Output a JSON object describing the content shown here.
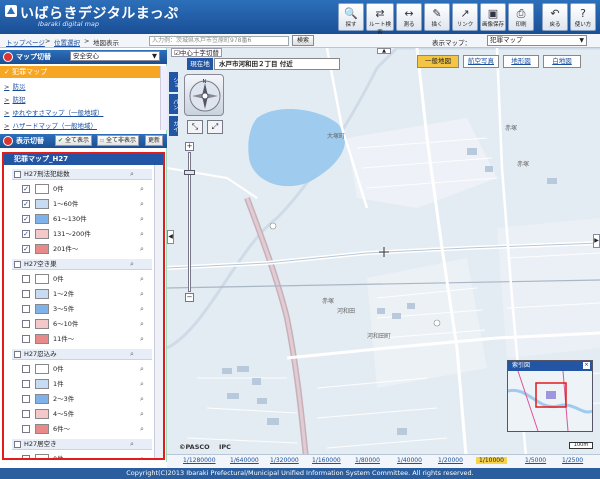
{
  "app": {
    "title": "いばらきデジタルまっぷ",
    "subtitle": "Ibaraki digital map"
  },
  "header_buttons": [
    {
      "label": "探す",
      "icon": "search-icon"
    },
    {
      "label": "ルート検索",
      "icon": "route-icon"
    },
    {
      "label": "測る",
      "icon": "measure-icon"
    },
    {
      "label": "描く",
      "icon": "draw-icon"
    },
    {
      "label": "リンク",
      "icon": "link-icon"
    },
    {
      "label": "画像保存",
      "icon": "save-image-icon"
    },
    {
      "label": "印刷",
      "icon": "print-icon"
    },
    {
      "label": "戻る",
      "icon": "back-icon"
    },
    {
      "label": "使い方",
      "icon": "help-icon"
    }
  ],
  "breadcrumb": {
    "top": "トップページ",
    "search": "位置選択",
    "current": "地図表示"
  },
  "address_search": {
    "placeholder": "入力例：茨城県水戸市笠原町978番6",
    "button": "検索"
  },
  "map_select": {
    "label": "表示マップ：",
    "value": "犯罪マップ"
  },
  "sidebar": {
    "map_switch_title": "マップ切替",
    "theme_value": "安全安心",
    "selected_item": "犯罪マップ",
    "items": [
      "防災",
      "防犯",
      "ゆれやすさマップ（一般地域）",
      "ハザードマップ（一般地域）"
    ],
    "display_switch_title": "表示切替",
    "show_all": "全て表示",
    "hide_all": "全て非表示",
    "refresh": "更新"
  },
  "layer_panel": {
    "title": "犯罪マップ_H27",
    "groups": [
      {
        "name": "H27刑法犯総数",
        "rows": [
          {
            "label": "0件",
            "color": "#ffffff",
            "checked": true
          },
          {
            "label": "1〜60件",
            "color": "#c7dcf2",
            "checked": true
          },
          {
            "label": "61〜130件",
            "color": "#7fb1ea",
            "checked": true
          },
          {
            "label": "131〜200件",
            "color": "#f4c8c8",
            "checked": true
          },
          {
            "label": "201件〜",
            "color": "#e98a8a",
            "checked": true
          }
        ]
      },
      {
        "name": "H27空き巣",
        "rows": [
          {
            "label": "0件",
            "color": "#ffffff",
            "checked": false
          },
          {
            "label": "1〜2件",
            "color": "#c7dcf2",
            "checked": false
          },
          {
            "label": "3〜5件",
            "color": "#7fb1ea",
            "checked": false
          },
          {
            "label": "6〜10件",
            "color": "#f4c8c8",
            "checked": false
          },
          {
            "label": "11件〜",
            "color": "#e98a8a",
            "checked": false
          }
        ]
      },
      {
        "name": "H27忍込み",
        "rows": [
          {
            "label": "0件",
            "color": "#ffffff",
            "checked": false
          },
          {
            "label": "1件",
            "color": "#c7dcf2",
            "checked": false
          },
          {
            "label": "2〜3件",
            "color": "#7fb1ea",
            "checked": false
          },
          {
            "label": "4〜5件",
            "color": "#f4c8c8",
            "checked": false
          },
          {
            "label": "6件〜",
            "color": "#e98a8a",
            "checked": false
          }
        ]
      },
      {
        "name": "H27居空き",
        "rows": [
          {
            "label": "0件",
            "color": "#ffffff",
            "checked": false
          },
          {
            "label": "1件",
            "color": "#c7dcf2",
            "checked": false
          }
        ]
      }
    ]
  },
  "map": {
    "center_toggle": "中心十字切替",
    "location_label": "現在地",
    "location_value": "水戸市河和田２丁目 付近",
    "tabs": [
      "一般地図",
      "航空写真",
      "地形図",
      "白地図"
    ],
    "active_tab": "一般地図",
    "side_tabs": [
      "ショ",
      "パン",
      "ガイ"
    ],
    "overview_title": "索引図",
    "scale_bar": "100m",
    "places": [
      "大塚町",
      "赤塚",
      "河和田",
      "赤塚",
      "河和田町",
      "赤塚"
    ],
    "credits": [
      "©PASCO",
      "IPC"
    ],
    "scales": [
      "1/1280000",
      "1/640000",
      "1/320000",
      "1/160000",
      "1/80000",
      "1/40000",
      "1/20000",
      "1/10000",
      "1/5000",
      "1/2500"
    ],
    "active_scale": "1/10000"
  },
  "footer": {
    "text": "Copyright(C)2013 Ibaraki Prefectural/Municipal Unified Information System Committee. All rights reserved."
  },
  "colors": {
    "header": "#1f5ea8",
    "accent": "#f6a623",
    "highlight": "#e41b1b"
  }
}
